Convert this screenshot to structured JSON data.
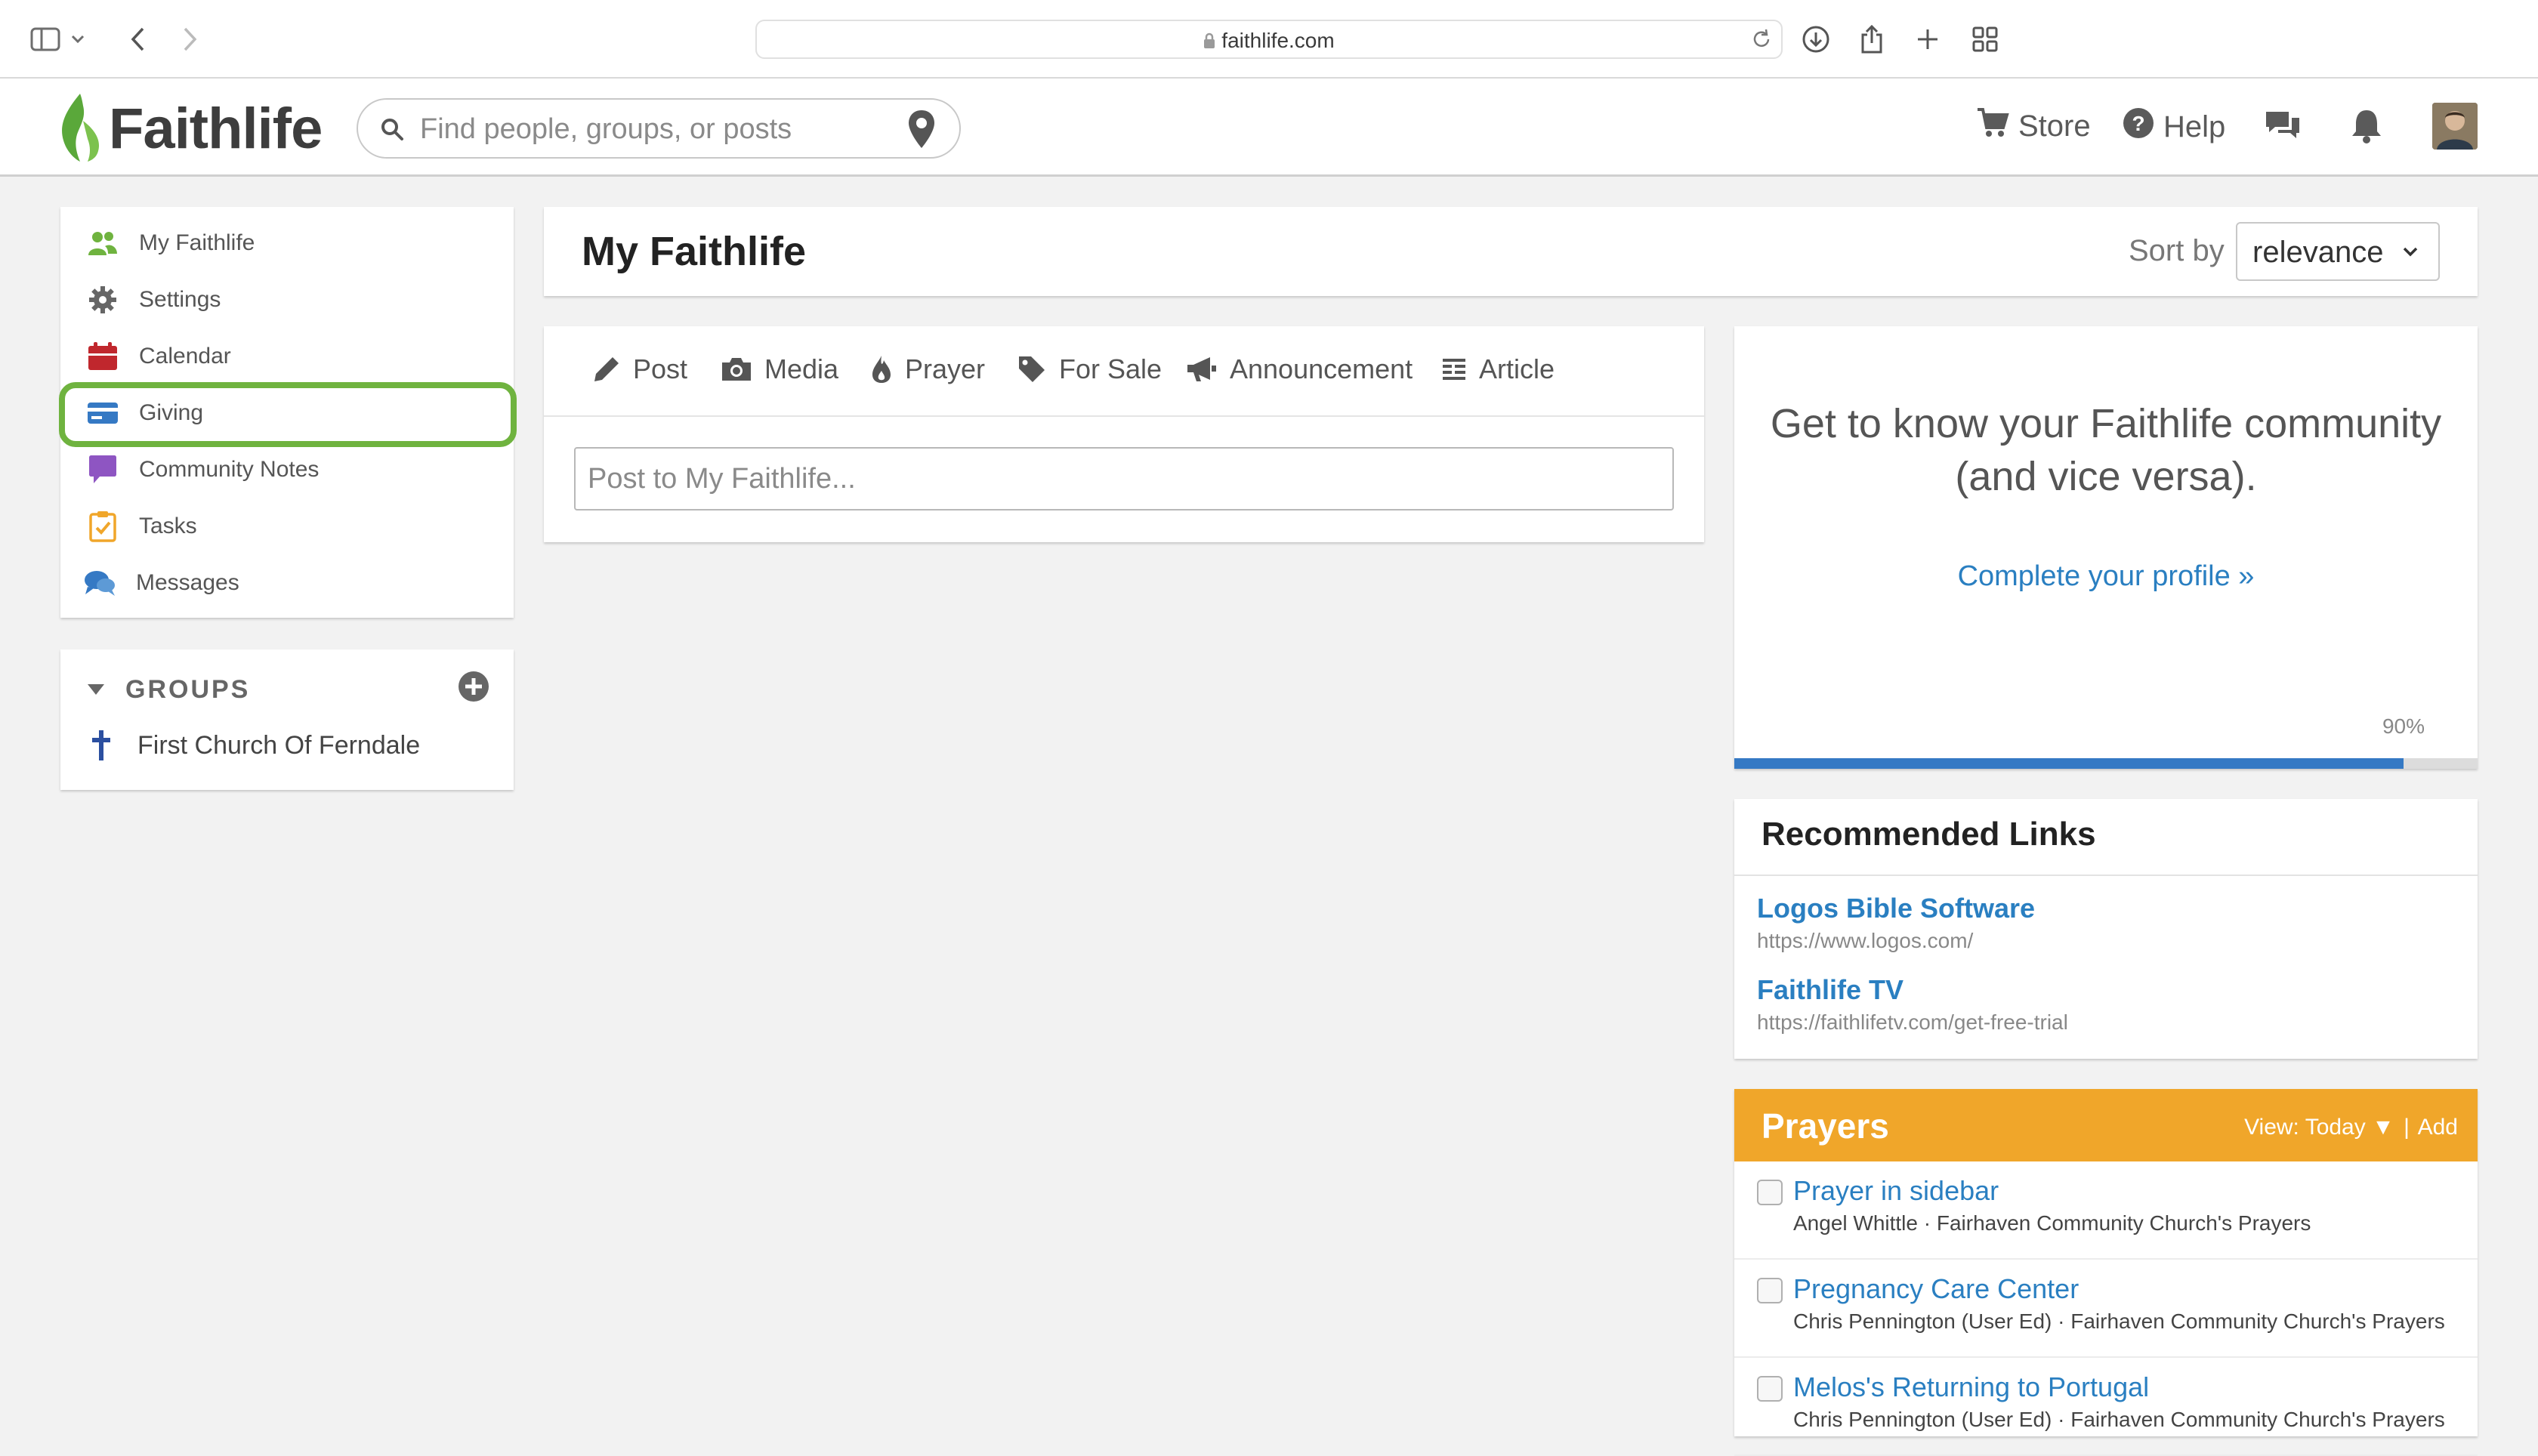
{
  "browser": {
    "url": "faithlife.com"
  },
  "header": {
    "logo_text": "Faithlife",
    "search_placeholder": "Find people, groups, or posts",
    "store_label": "Store",
    "help_label": "Help"
  },
  "sidebar": {
    "items": [
      {
        "label": "My Faithlife",
        "icon": "people-icon"
      },
      {
        "label": "Settings",
        "icon": "gear-icon"
      },
      {
        "label": "Calendar",
        "icon": "calendar-icon"
      },
      {
        "label": "Giving",
        "icon": "credit-card-icon"
      },
      {
        "label": "Community Notes",
        "icon": "speech-bubble-icon"
      },
      {
        "label": "Tasks",
        "icon": "clipboard-check-icon"
      },
      {
        "label": "Messages",
        "icon": "chat-bubbles-icon"
      }
    ],
    "groups_title": "GROUPS",
    "groups": [
      {
        "label": "First Church Of Ferndale"
      }
    ]
  },
  "main": {
    "title": "My Faithlife",
    "sort_label": "Sort by",
    "sort_value": "relevance",
    "composer_tabs": [
      "Post",
      "Media",
      "Prayer",
      "For Sale",
      "Announcement",
      "Article"
    ],
    "post_placeholder": "Post to My Faithlife..."
  },
  "profile": {
    "text": "Get to know your Faithlife community (and vice versa).",
    "link": "Complete your profile »",
    "progress_label": "90%",
    "progress": 0.9
  },
  "recommended_links": {
    "title": "Recommended Links",
    "items": [
      {
        "title": "Logos Bible Software",
        "url": "https://www.logos.com/"
      },
      {
        "title": "Faithlife TV",
        "url": "https://faithlifetv.com/get-free-trial"
      }
    ]
  },
  "prayers": {
    "title": "Prayers",
    "view_label": "View: Today ▼",
    "separator": "|",
    "add_label": "Add",
    "items": [
      {
        "title": "Prayer in sidebar",
        "sub": "Angel Whittle · Fairhaven Community Church's Prayers"
      },
      {
        "title": "Pregnancy Care Center",
        "sub": "Chris Pennington (User Ed) · Fairhaven Community Church's Prayers"
      },
      {
        "title": "Melos's Returning to Portugal",
        "sub": "Chris Pennington (User Ed) · Fairhaven Community Church's Prayers"
      }
    ]
  },
  "colors": {
    "brand_green": "#6fb33f",
    "link_blue": "#2a7fc1",
    "prayers_orange": "#f0a62a",
    "progress_blue": "#3579c4"
  }
}
